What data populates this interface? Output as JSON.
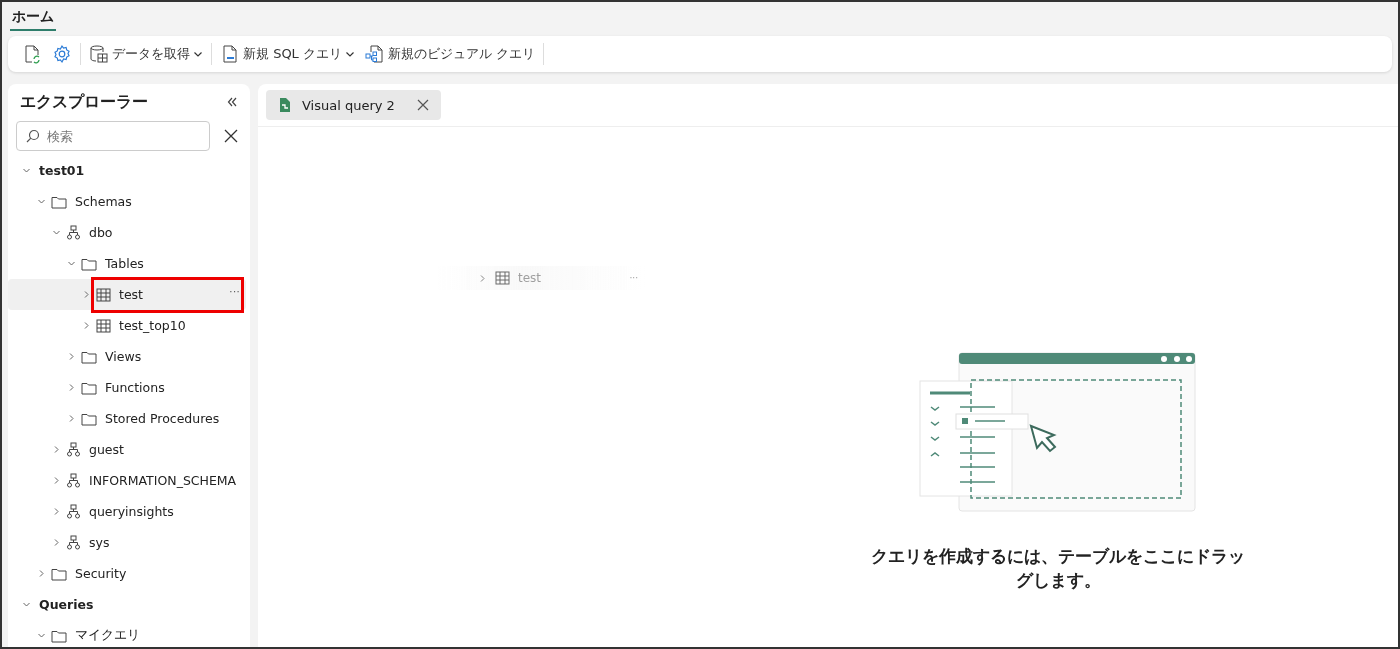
{
  "ribbon_tabs": [
    {
      "label": "ホーム",
      "selected": true
    }
  ],
  "toolbar": [
    {
      "kind": "icon"
    },
    {
      "kind": "icon"
    },
    {
      "kind": "sep"
    },
    {
      "kind": "button",
      "label": "データを取得",
      "dropdown": true
    },
    {
      "kind": "sep"
    },
    {
      "kind": "button",
      "label": "新規 SQL クエリ",
      "dropdown": true
    },
    {
      "kind": "button",
      "label": "新規のビジュアル クエリ",
      "dropdown": false
    },
    {
      "kind": "sep"
    }
  ],
  "explorer": {
    "title": "エクスプローラー",
    "search": {
      "placeholder": "検索"
    },
    "tree": [
      {
        "label": "test01",
        "kind": "root",
        "expanded": true,
        "children": [
          {
            "label": "Schemas",
            "kind": "folder",
            "expanded": true,
            "children": [
              {
                "label": "dbo",
                "kind": "schema",
                "expanded": true,
                "children": [
                  {
                    "label": "Tables",
                    "kind": "folder",
                    "expanded": true,
                    "children": [
                      {
                        "label": "test",
                        "kind": "table",
                        "expanded": false,
                        "selected": true,
                        "annotated": true,
                        "more": "···"
                      },
                      {
                        "label": "test_top10",
                        "kind": "table",
                        "expanded": false,
                        "selected": false,
                        "annotated": false
                      }
                    ]
                  },
                  {
                    "label": "Views",
                    "kind": "folder",
                    "expanded": false
                  },
                  {
                    "label": "Functions",
                    "kind": "folder",
                    "expanded": false
                  },
                  {
                    "label": "Stored Procedures",
                    "kind": "folder",
                    "expanded": false
                  }
                ]
              },
              {
                "label": "guest",
                "kind": "schema",
                "expanded": false
              },
              {
                "label": "INFORMATION_SCHEMA",
                "kind": "schema",
                "expanded": false
              },
              {
                "label": "queryinsights",
                "kind": "schema",
                "expanded": false
              },
              {
                "label": "sys",
                "kind": "schema",
                "expanded": false
              }
            ]
          },
          {
            "label": "Security",
            "kind": "folder",
            "expanded": false
          }
        ]
      },
      {
        "label": "Queries",
        "kind": "root",
        "expanded": true,
        "children": [
          {
            "label": "マイクエリ",
            "kind": "folder",
            "expanded": true
          }
        ]
      }
    ]
  },
  "editor_tabs": [
    {
      "label": "Visual query 2",
      "selected": true
    }
  ],
  "drag_ghost": {
    "label": "test",
    "kind": "table",
    "more": "···"
  },
  "empty_state": {
    "message": "クエリを作成するには、テーブルをここにドラッグします。"
  }
}
